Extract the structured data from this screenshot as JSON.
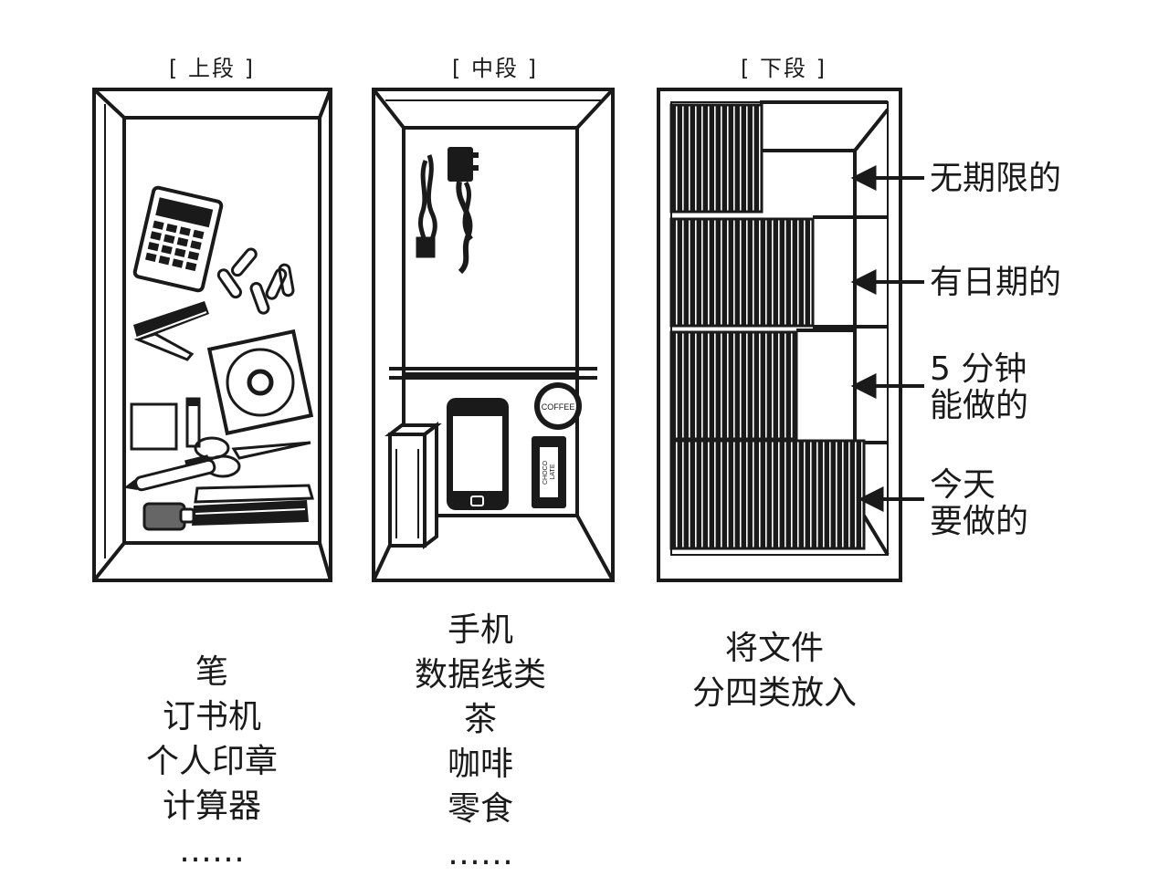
{
  "sections": {
    "top": {
      "header": "[ 上段 ]",
      "items": [
        "笔",
        "订书机",
        "个人印章",
        "计算器",
        "……"
      ]
    },
    "middle": {
      "header": "[ 中段 ]",
      "items": [
        "手机",
        "数据线类",
        "茶",
        "咖啡",
        "零食",
        "……"
      ]
    },
    "bottom": {
      "header": "[ 下段 ]",
      "items": [
        "将文件",
        "分四类放入"
      ]
    }
  },
  "file_labels": [
    "无期限的",
    "有日期的",
    "5 分钟\n能做的",
    "今天\n要做的"
  ],
  "product_labels": {
    "coffee": "COFFEE",
    "choco": "CHOCO\nLATE"
  },
  "colors": {
    "ink": "#1a1a1a",
    "background": "#ffffff"
  }
}
